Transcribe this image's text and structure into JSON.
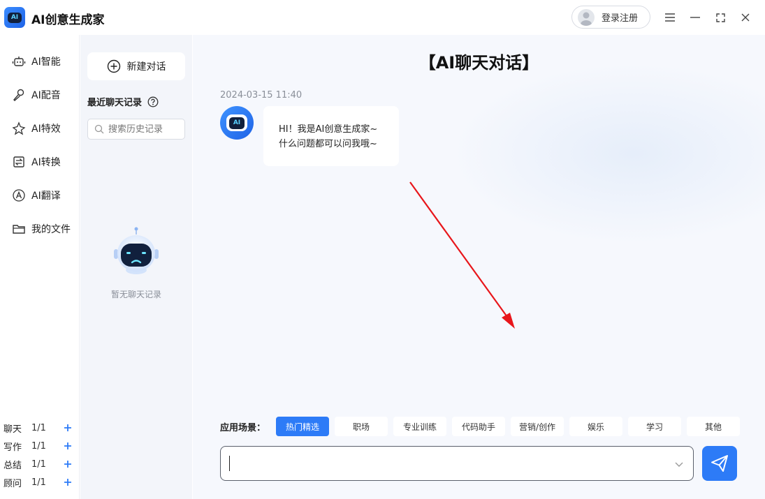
{
  "app": {
    "title": "AI创意生成家",
    "logo_text": "AI"
  },
  "titlebar": {
    "login_label": "登录注册"
  },
  "nav": {
    "items": [
      {
        "label": "AI智能",
        "icon": "robot-icon"
      },
      {
        "label": "AI配音",
        "icon": "microphone-icon"
      },
      {
        "label": "AI特效",
        "icon": "sparkle-icon"
      },
      {
        "label": "AI转换",
        "icon": "convert-icon"
      },
      {
        "label": "AI翻译",
        "icon": "translate-icon"
      },
      {
        "label": "我的文件",
        "icon": "folder-icon"
      }
    ],
    "quotas": [
      {
        "name": "聊天",
        "value": "1/1"
      },
      {
        "name": "写作",
        "value": "1/1"
      },
      {
        "name": "总结",
        "value": "1/1"
      },
      {
        "name": "顾问",
        "value": "1/1"
      }
    ]
  },
  "history": {
    "new_chat_label": "新建对话",
    "recent_title": "最近聊天记录",
    "search_placeholder": "搜索历史记录",
    "empty_text": "暂无聊天记录"
  },
  "chat": {
    "title": "【AI聊天对话】",
    "timestamp": "2024-03-15 11:40",
    "bot_avatar_text": "AI",
    "message_line1": "HI！我是AI创意生成家~",
    "message_line2": "什么问题都可以问我哦~"
  },
  "scenes": {
    "label": "应用场景：",
    "chips": [
      "热门精选",
      "职场",
      "专业训练",
      "代码助手",
      "营销/创作",
      "娱乐",
      "学习",
      "其他"
    ],
    "active_index": 0
  },
  "input": {
    "value": "",
    "placeholder": ""
  },
  "colors": {
    "accent": "#2d7bf7",
    "annotation_arrow": "#e8161b"
  }
}
